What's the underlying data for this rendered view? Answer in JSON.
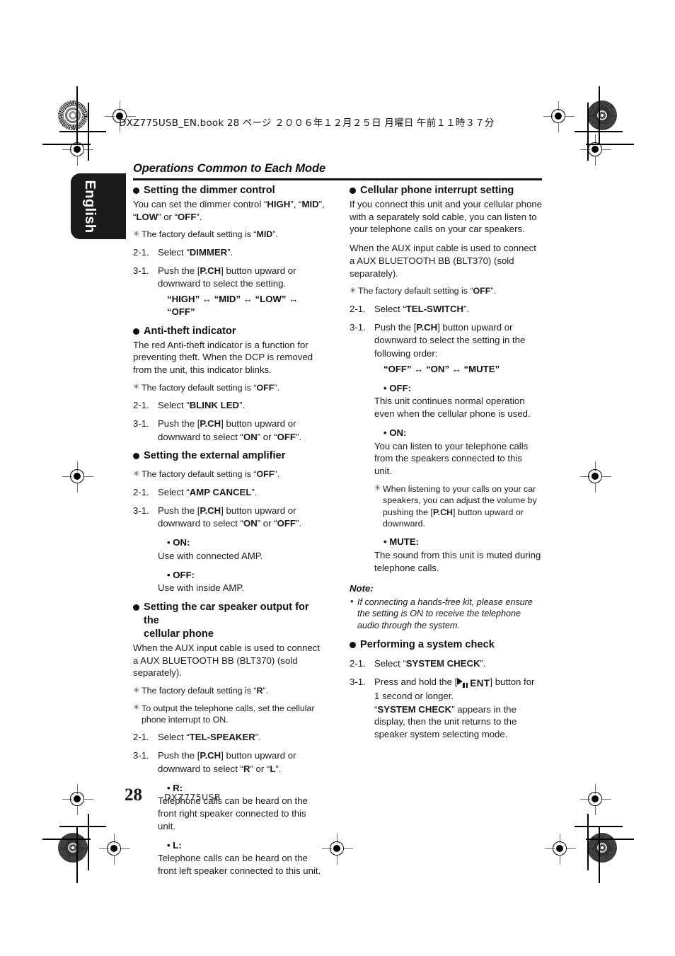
{
  "print_marks": {
    "file_line": "DXZ775USB_EN.book  28 ページ  ２００６年１２月２５日   月曜日   午前１１時３７分"
  },
  "lang_tab": {
    "label": "English"
  },
  "header": {
    "section_title": "Operations Common to Each Mode"
  },
  "footer": {
    "page_number": "28",
    "model": "DXZ775USB"
  },
  "left_column": {
    "dimmer": {
      "heading": "Setting the dimmer control",
      "body": "You can set the dimmer control “HIGH”, “MID”, “LOW” or “OFF”.",
      "note": "The factory default setting is “MID”.",
      "step_2_num": "2-1.",
      "step_2_text": "Select “DIMMER”.",
      "step_3_num": "3-1.",
      "step_3_text": "Push the [P.CH] button upward or downward to select the setting.",
      "sequence": "“HIGH” ↔ “MID” ↔ “LOW” ↔ “OFF”"
    },
    "antitheft": {
      "heading": "Anti-theft indicator",
      "body": "The red Anti-theft indicator is a function for preventing theft. When the DCP is removed from the unit, this indicator blinks.",
      "note": "The factory default setting is “OFF”.",
      "step_2_num": "2-1.",
      "step_2_text": "Select “BLINK LED”.",
      "step_3_num": "3-1.",
      "step_3_text": "Push the [P.CH] button upward or downward to select “ON” or “OFF”."
    },
    "amplifier": {
      "heading": "Setting the external amplifier",
      "note": "The factory default setting is “OFF”.",
      "step_2_num": "2-1.",
      "step_2_text": "Select “AMP CANCEL”.",
      "step_3_num": "3-1.",
      "step_3_text": "Push the [P.CH] button upward or downward to select “ON” or “OFF”.",
      "opt_on_label": "• ON:",
      "opt_on_text": "Use with connected AMP.",
      "opt_off_label": "• OFF:",
      "opt_off_text": "Use with inside AMP."
    },
    "car_speaker": {
      "heading_line1": "Setting the car speaker output for the",
      "heading_line2": "cellular phone",
      "body": "When the AUX input cable is used to connect a AUX BLUETOOTH BB (BLT370) (sold separately).",
      "note1": "The factory default setting is “R”.",
      "note2": "To output the telephone calls, set the cellular phone interrupt to ON.",
      "step_2_num": "2-1.",
      "step_2_text": "Select “TEL-SPEAKER”.",
      "step_3_num": "3-1.",
      "step_3_text": "Push the [P.CH] button upward or downward to select “R” or “L”.",
      "opt_r_label": "• R:",
      "opt_r_text": "Telephone calls can be heard on the front right speaker connected to this unit.",
      "opt_l_label": "• L:",
      "opt_l_text": "Telephone calls can be heard on the front left speaker connected to this unit."
    }
  },
  "right_column": {
    "cellular_interrupt": {
      "heading": "Cellular phone interrupt setting",
      "body1": "If you connect this unit and your cellular phone with a separately sold cable, you can listen to your telephone calls on your car speakers.",
      "body2": "When the AUX input cable is used to connect a AUX BLUETOOTH BB (BLT370) (sold separately).",
      "note": "The factory default setting is “OFF”.",
      "step_2_num": "2-1.",
      "step_2_text": "Select “TEL-SWITCH”.",
      "step_3_num": "3-1.",
      "step_3_text": "Push the [P.CH] button upward or downward to select the setting in the following order:",
      "sequence": "“OFF” ↔ “ON” ↔ “MUTE”",
      "opt_off_label": "• OFF:",
      "opt_off_text": "This unit continues normal operation even when the cellular phone is used.",
      "opt_on_label": "• ON:",
      "opt_on_text": "You can listen to your telephone calls from the speakers connected to this unit.",
      "opt_on_note": "When listening to your calls on your car speakers, you can adjust the volume by pushing the [P.CH] button upward or downward.",
      "opt_mute_label": "• MUTE:",
      "opt_mute_text": "The sound from this unit is muted during telephone calls."
    },
    "note_block": {
      "heading": "Note:",
      "item": "If connecting a hands-free kit, please ensure the setting is ON to receive the telephone audio through the system."
    },
    "system_check": {
      "heading": "Performing a system check",
      "step_2_num": "2-1.",
      "step_2_text": "Select “SYSTEM CHECK”.",
      "step_3_num": "3-1.",
      "step_3_prefix": "Press and hold the [",
      "step_3_key": "ENT",
      "step_3_suffix": "] button for 1 second or longer.",
      "result": "“SYSTEM CHECK” appears in the display, then the unit returns to the speaker system selecting mode."
    }
  }
}
